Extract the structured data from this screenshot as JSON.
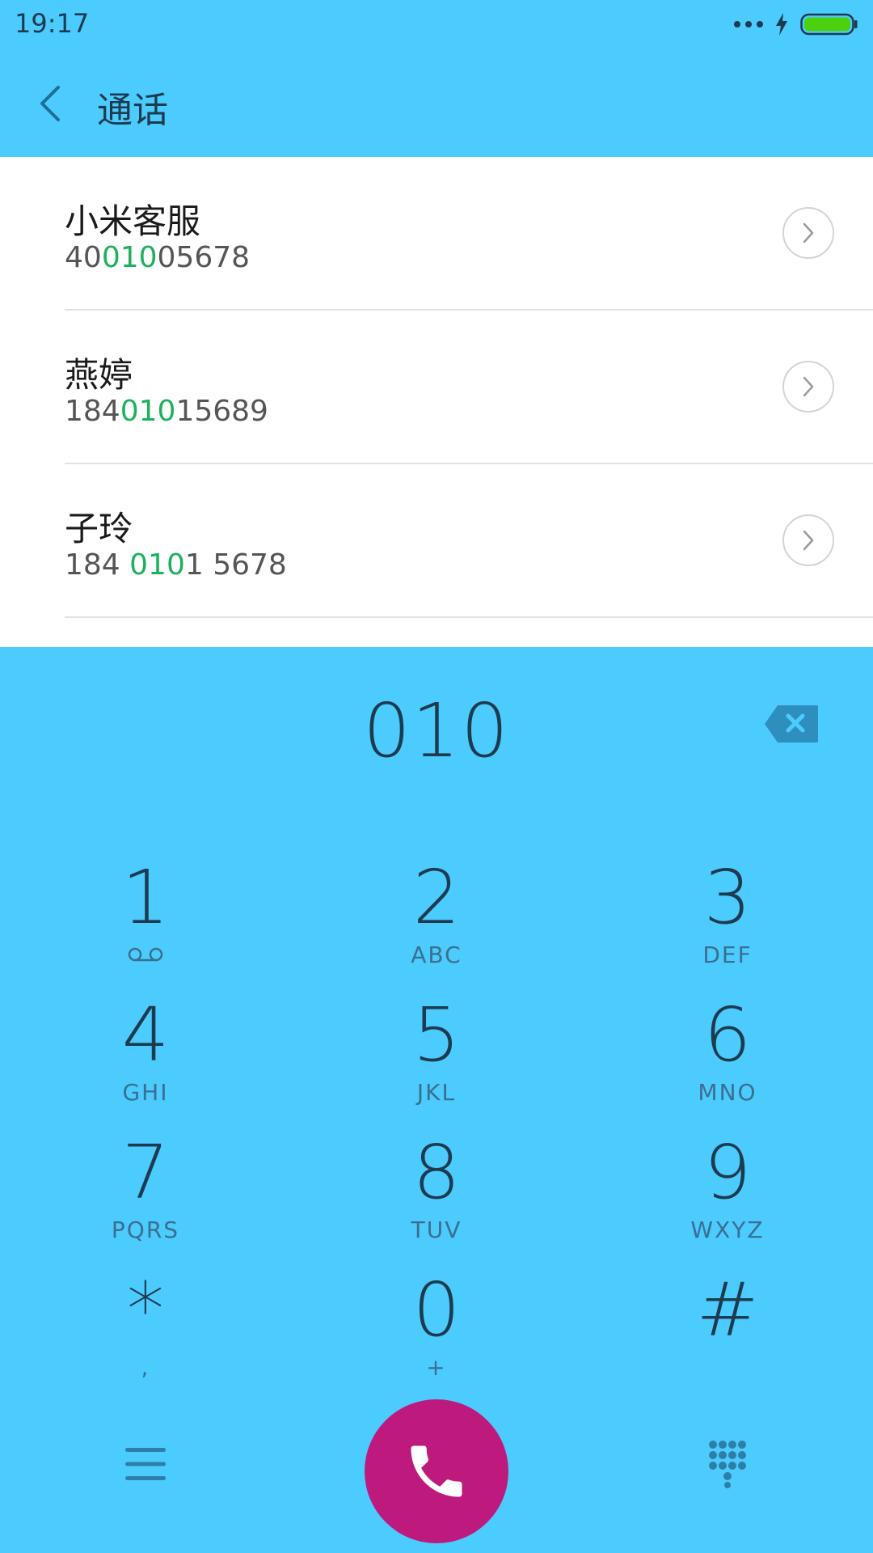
{
  "status_bar": {
    "time": "19:17",
    "icons": [
      "more-dots-icon",
      "charging-bolt-icon",
      "battery-icon"
    ]
  },
  "header": {
    "title": "通话",
    "back_icon": "chevron-left-icon"
  },
  "results": [
    {
      "name": "小米客服",
      "number_pre": "40",
      "number_match": "010",
      "number_post": "05678"
    },
    {
      "name": "燕婷",
      "number_pre": "184",
      "number_match": "010",
      "number_post": "15689"
    },
    {
      "name": "子玲",
      "number_pre": "184 ",
      "number_match": "010",
      "number_post": "1 5678"
    }
  ],
  "dialer": {
    "input": "010",
    "backspace_icon": "backspace-icon"
  },
  "keypad": [
    {
      "digit": "1",
      "letters": ""
    },
    {
      "digit": "2",
      "letters": "ABC"
    },
    {
      "digit": "3",
      "letters": "DEF"
    },
    {
      "digit": "4",
      "letters": "GHI"
    },
    {
      "digit": "5",
      "letters": "JKL"
    },
    {
      "digit": "6",
      "letters": "MNO"
    },
    {
      "digit": "7",
      "letters": "PQRS"
    },
    {
      "digit": "8",
      "letters": "TUV"
    },
    {
      "digit": "9",
      "letters": "WXYZ"
    },
    {
      "digit": "*",
      "letters": ","
    },
    {
      "digit": "0",
      "letters": "+"
    },
    {
      "digit": "#",
      "letters": ""
    }
  ],
  "bottom_bar": {
    "menu_icon": "menu-icon",
    "call_icon": "phone-icon",
    "dialpad_icon": "dialpad-icon"
  },
  "colors": {
    "accent_blue": "#4CCBFE",
    "call_button": "#BE1A7D",
    "match_highlight": "#1DB15C"
  }
}
